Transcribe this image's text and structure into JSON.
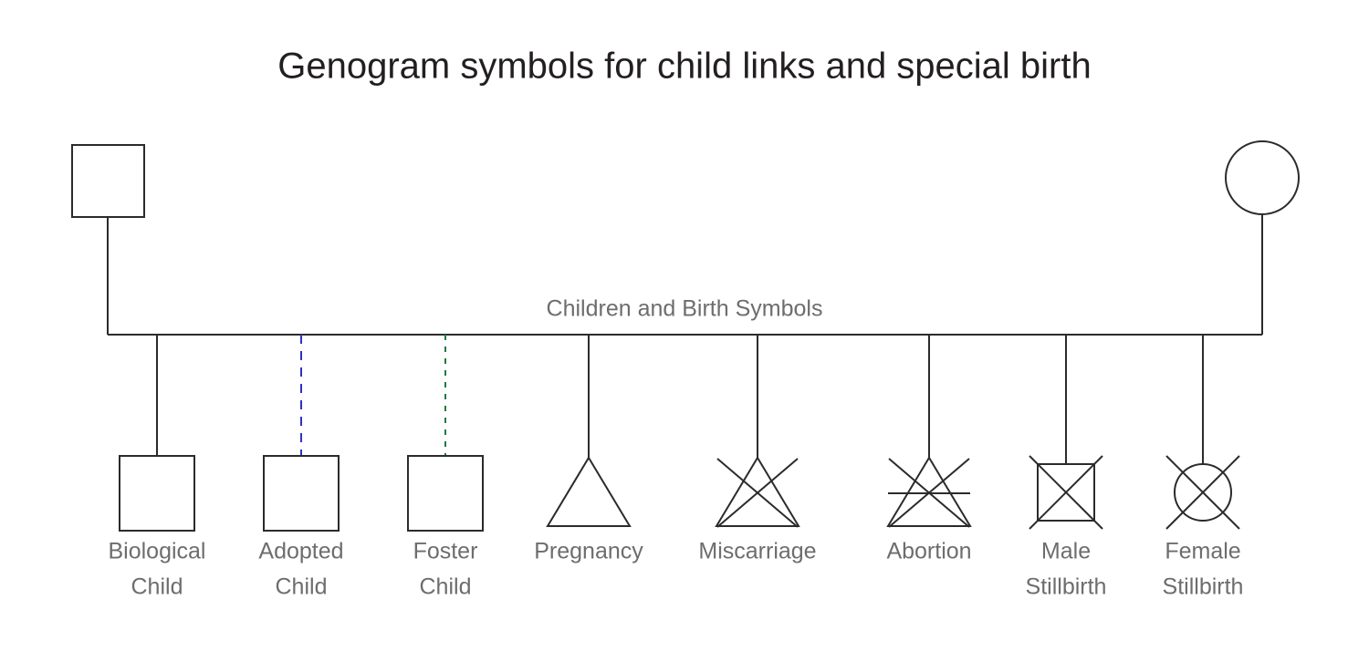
{
  "title": "Genogram symbols for child links and special birth",
  "union": {
    "label": "Children and Birth Symbols",
    "father": {
      "symbol_name": "male-square",
      "shape": "square"
    },
    "mother": {
      "symbol_name": "female-circle",
      "shape": "circle"
    }
  },
  "colors": {
    "line": "#2b2b2b",
    "title_text": "#231f20",
    "label_text": "#6d6d6d",
    "adopted_link": "#2f31c4",
    "foster_link": "#1f7a42",
    "background": "#ffffff"
  },
  "children": [
    {
      "id": "biological-child",
      "label_line1": "Biological",
      "label_line2": "Child",
      "symbol": "square",
      "link_style": "solid",
      "link_color": "#2b2b2b"
    },
    {
      "id": "adopted-child",
      "label_line1": "Adopted",
      "label_line2": "Child",
      "symbol": "square",
      "link_style": "dashed",
      "link_color": "#2f31c4"
    },
    {
      "id": "foster-child",
      "label_line1": "Foster",
      "label_line2": "Child",
      "symbol": "square",
      "link_style": "dotted",
      "link_color": "#1f7a42"
    },
    {
      "id": "pregnancy",
      "label_line1": "Pregnancy",
      "label_line2": "",
      "symbol": "triangle",
      "link_style": "solid",
      "link_color": "#2b2b2b"
    },
    {
      "id": "miscarriage",
      "label_line1": "Miscarriage",
      "label_line2": "",
      "symbol": "triangle-crossed",
      "link_style": "solid",
      "link_color": "#2b2b2b"
    },
    {
      "id": "abortion",
      "label_line1": "Abortion",
      "label_line2": "",
      "symbol": "triangle-crossed-with-bar",
      "link_style": "solid",
      "link_color": "#2b2b2b"
    },
    {
      "id": "male-stillbirth",
      "label_line1": "Male",
      "label_line2": "Stillbirth",
      "symbol": "square-crossed",
      "link_style": "solid",
      "link_color": "#2b2b2b"
    },
    {
      "id": "female-stillbirth",
      "label_line1": "Female",
      "label_line2": "Stillbirth",
      "symbol": "circle-crossed",
      "link_style": "solid",
      "link_color": "#2b2b2b"
    }
  ]
}
